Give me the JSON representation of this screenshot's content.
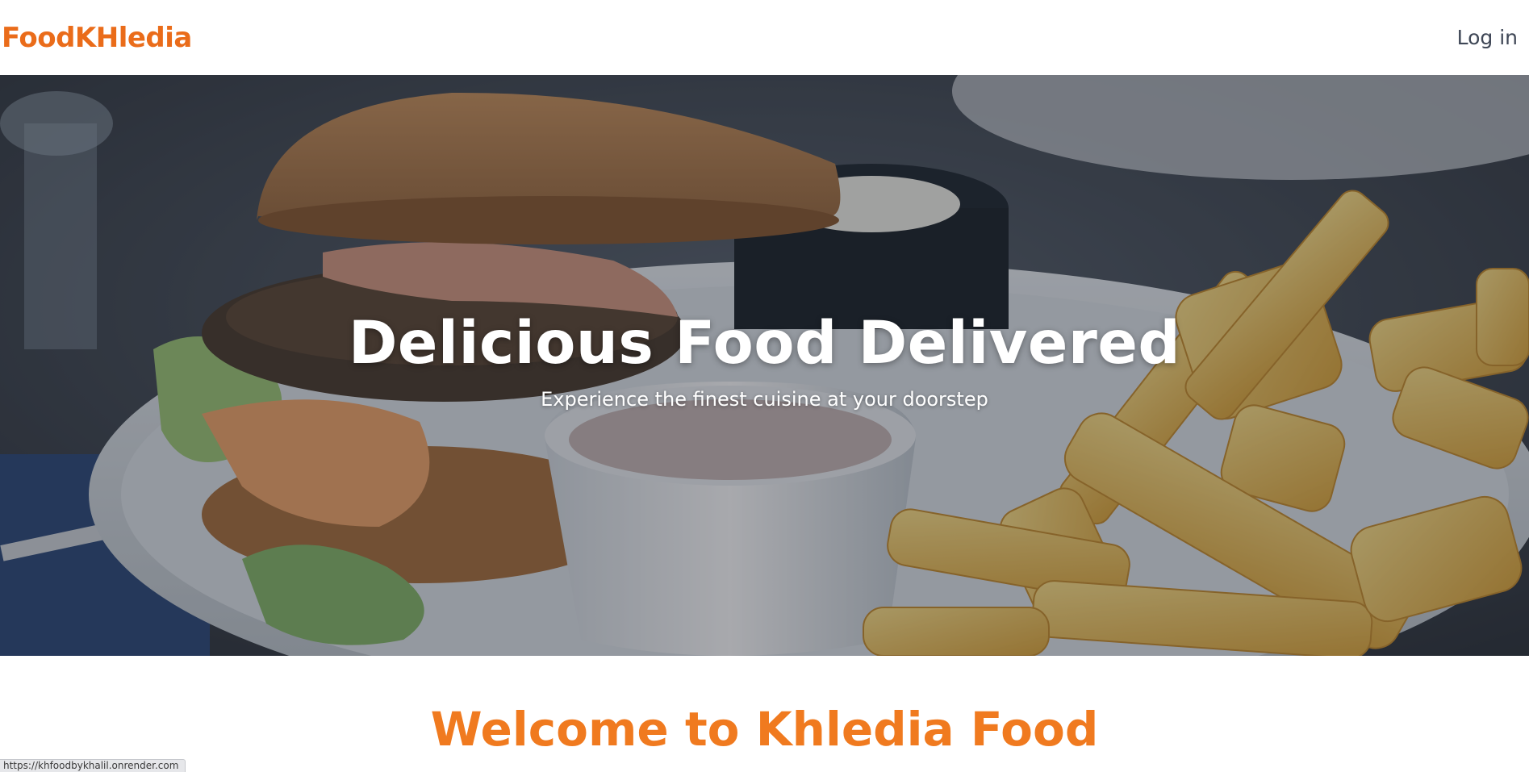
{
  "navbar": {
    "brand": "FoodKHledia",
    "login_label": "Log in"
  },
  "hero": {
    "title": "Delicious Food Delivered",
    "subtitle": "Experience the finest cuisine at your doorstep",
    "image_description_icon": "burger-and-fries-photo"
  },
  "section": {
    "heading": "Welcome to Khledia Food"
  },
  "status_bar": {
    "url": "https://khfoodbykhalil.onrender.com"
  },
  "colors": {
    "brand": "#ea6c1a",
    "heading_accent": "#f07a1f",
    "nav_text": "#3f4756",
    "hero_text": "#ffffff"
  }
}
